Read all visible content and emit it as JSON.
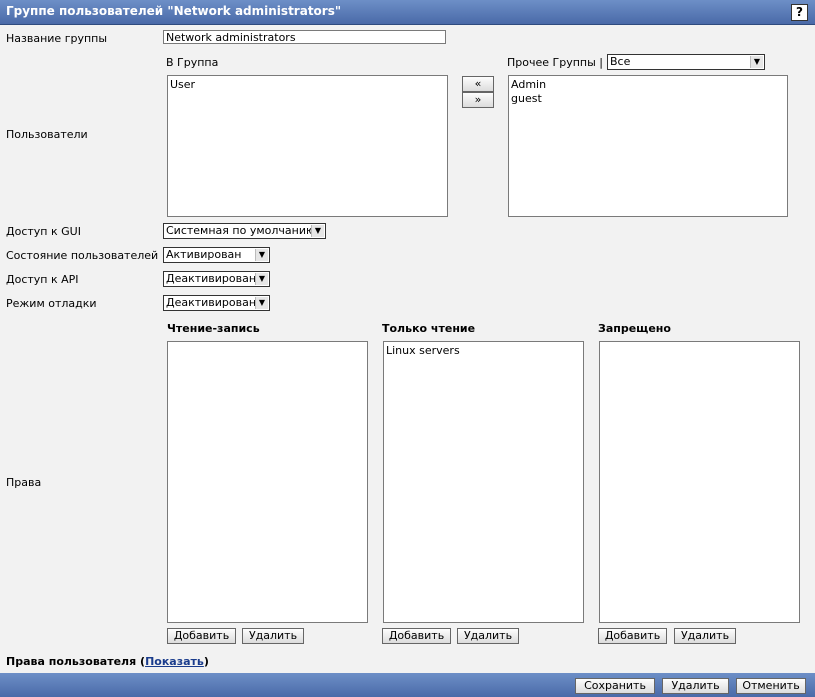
{
  "header": {
    "title": "Группе пользователей \"Network administrators\"",
    "help_label": "?"
  },
  "group_name": {
    "label": "Название группы",
    "value": "Network administrators"
  },
  "users": {
    "label": "Пользователи",
    "in_group_label": "В Группа",
    "in_group": [
      "User"
    ],
    "add_arrow": "«",
    "remove_arrow": "»",
    "other_groups_label": "Прочее Группы |",
    "other_groups_select": "Все",
    "other": [
      "Admin",
      "guest"
    ]
  },
  "gui_access": {
    "label": "Доступ к GUI",
    "value": "Системная по умолчанию"
  },
  "users_status": {
    "label": "Состояние пользователей",
    "value": "Активирован"
  },
  "api_access": {
    "label": "Доступ к API",
    "value": "Деактивирован"
  },
  "debug_mode": {
    "label": "Режим отладки",
    "value": "Деактивирован"
  },
  "rights": {
    "label": "Права",
    "read_write": {
      "label": "Чтение-запись",
      "items": []
    },
    "read_only": {
      "label": "Только чтение",
      "items": [
        "Linux servers"
      ]
    },
    "deny": {
      "label": "Запрещено",
      "items": []
    },
    "add_label": "Добавить",
    "delete_label": "Удалить"
  },
  "user_rights": {
    "label": "Права пользователя",
    "open": "(",
    "link": "Показать",
    "close": ")"
  },
  "footer": {
    "save": "Сохранить",
    "delete": "Удалить",
    "cancel": "Отменить"
  }
}
